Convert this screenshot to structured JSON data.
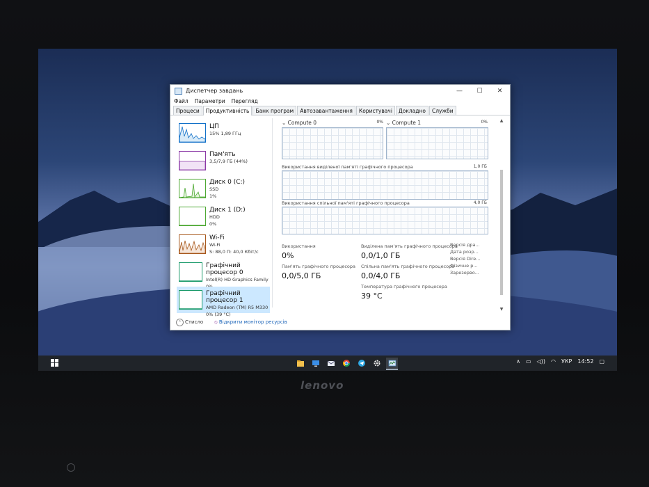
{
  "window": {
    "title": "Диспетчер завдань",
    "controls": {
      "minimize": "—",
      "maximize": "☐",
      "close": "✕"
    }
  },
  "menu": [
    "Файл",
    "Параметри",
    "Перегляд"
  ],
  "tabs": [
    "Процеси",
    "Продуктивність",
    "Банк програм",
    "Автозавантаження",
    "Користувачі",
    "Докладно",
    "Служби"
  ],
  "active_tab": "Продуктивність",
  "resources": [
    {
      "title": "ЦП",
      "sub1": "15% 1,89 ГГц",
      "sub2": "",
      "graph_color": "#1170c8"
    },
    {
      "title": "Пам'ять",
      "sub1": "3,5/7,9 ГБ (44%)",
      "sub2": "",
      "graph_color": "#8b39a6"
    },
    {
      "title": "Диск 0 (C:)",
      "sub1": "SSD",
      "sub2": "1%",
      "graph_color": "#4da832"
    },
    {
      "title": "Диск 1 (D:)",
      "sub1": "HDD",
      "sub2": "0%",
      "graph_color": "#4da832"
    },
    {
      "title": "Wi-Fi",
      "sub1": "Wi-Fi",
      "sub2": "S: 88,0  П: 40,0 Кбіт/с",
      "graph_color": "#a7581c"
    },
    {
      "title": "Графічний процесор 0",
      "sub1": "Intel(R) HD Graphics Family",
      "sub2": "0%",
      "graph_color": "#1a9a6a"
    },
    {
      "title": "Графічний процесор 1",
      "sub1": "AMD Radeon (TM) R5 M330",
      "sub2": "0% (39 °C)",
      "graph_color": "#1a9a6a"
    }
  ],
  "gpu_panel": {
    "engines": [
      {
        "name": "Compute 0",
        "pct": "0%"
      },
      {
        "name": "Compute 1",
        "pct": "0%"
      }
    ],
    "dedicated_label": "Використання виділеної пам'яті графічного процесора",
    "dedicated_max": "1,0 ГБ",
    "shared_label": "Використання спільної пам'яті графічного процесора",
    "shared_max": "4,0 ГБ",
    "stats": {
      "usage_label": "Використання",
      "usage_value": "0%",
      "gpu_mem_label": "Пам'ять графічного процесора",
      "gpu_mem_value": "0,0/5,0 ГБ",
      "ded_label": "Виділена пам'ять графічного процесора",
      "ded_value": "0,0/1,0 ГБ",
      "shared_label": "Спільна пам'ять графічного процесора",
      "shared_value": "0,0/4,0 ГБ",
      "temp_label": "Температура графічного процесора",
      "temp_value": "39 °C"
    },
    "props": [
      "Версія дра...",
      "Дата розр...",
      "Версія Dire...",
      "Фізичне р...",
      "Зарезерво..."
    ]
  },
  "footer": {
    "less": "Стисло",
    "monitor": "Відкрити монітор ресурсів"
  },
  "taskbar": {
    "icons": [
      "explorer-icon",
      "monitor-icon",
      "mail-icon",
      "chrome-icon",
      "telegram-icon",
      "settings-icon",
      "task-manager-icon"
    ],
    "lang": "УКР",
    "time": "14:52"
  },
  "brand": "lenovo"
}
